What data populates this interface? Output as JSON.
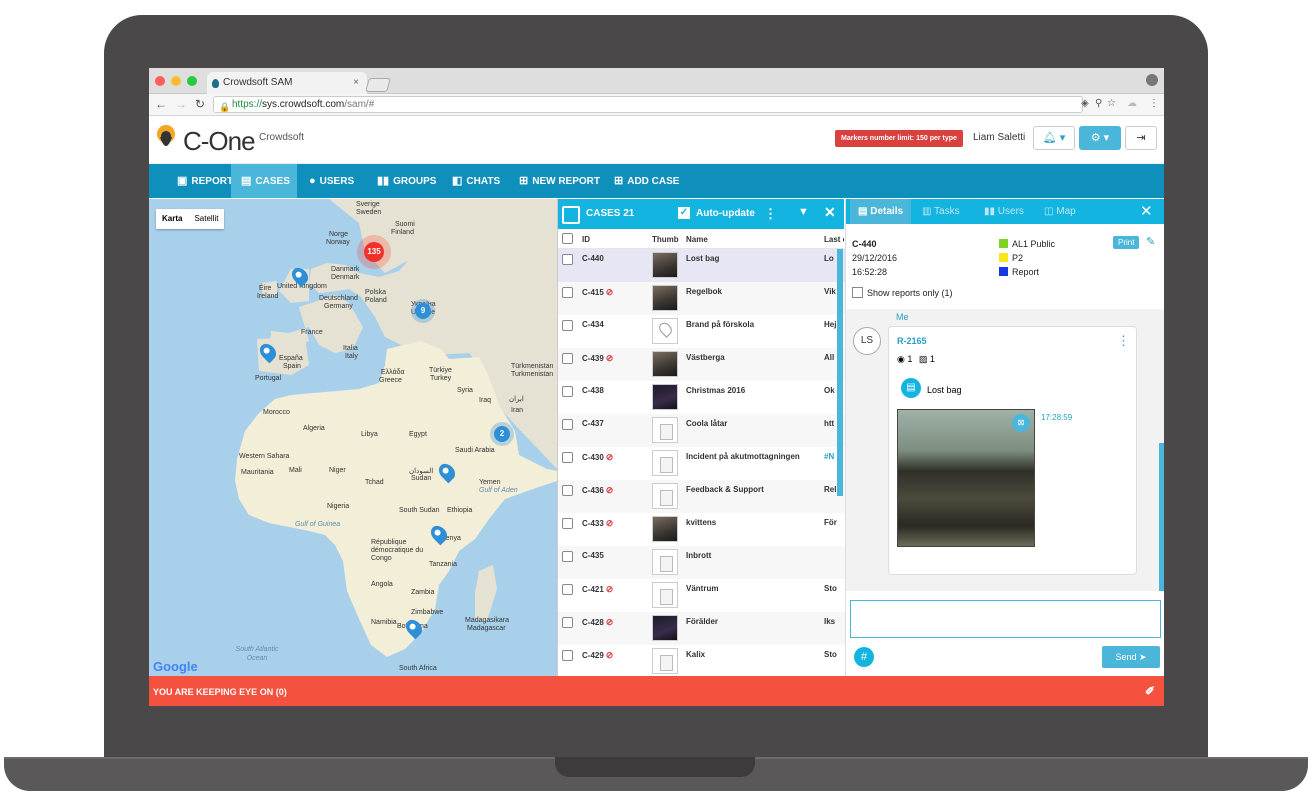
{
  "browser": {
    "tab_title": "Crowdsoft SAM",
    "tab_close": "×",
    "url_scheme": "https://",
    "url_host": "sys.crowdsoft.com",
    "url_path": "/sam/#"
  },
  "header": {
    "logo_text": "C-One",
    "org_name": "Crowdsoft",
    "limit_badge": "Markers number limit: 150 per type",
    "user_name": "Liam Saletti"
  },
  "nav": {
    "items": [
      {
        "label": "REPORTS",
        "icon": "reports-icon"
      },
      {
        "label": "CASES",
        "icon": "cases-icon"
      },
      {
        "label": "USERS",
        "icon": "users-icon"
      },
      {
        "label": "GROUPS",
        "icon": "groups-icon"
      },
      {
        "label": "CHATS",
        "icon": "chats-icon"
      },
      {
        "label": "NEW REPORT",
        "icon": "new-report-icon"
      },
      {
        "label": "ADD CASE",
        "icon": "add-case-icon"
      }
    ]
  },
  "map": {
    "type_map": "Karta",
    "type_satellite": "Satellit",
    "google": "Google",
    "clusters": [
      "135",
      "9",
      "2"
    ],
    "labels": {
      "sverige": "Sverige",
      "sweden": "Sweden",
      "suomi": "Suomi",
      "finland": "Finland",
      "norge": "Norge",
      "norway": "Norway",
      "danmark": "Danmark",
      "denmark": "Denmark",
      "eire": "Éire",
      "ireland": "Ireland",
      "united_kingdom": "United Kingdom",
      "deutschland": "Deutschland",
      "germany": "Germany",
      "polska": "Polska",
      "poland": "Poland",
      "ukraina": "Україна",
      "ukraine": "Ukraine",
      "france": "France",
      "italia": "Italia",
      "italy": "Italy",
      "espana": "España",
      "spain": "Spain",
      "portugal": "Portugal",
      "greece": "Ελλάδα",
      "greece_en": "Greece",
      "turkiye": "Türkiye",
      "turkey": "Turkey",
      "turkmenistan": "Türkmenistan",
      "turkmenistan_en": "Turkmenistan",
      "iran": "ایران",
      "iran_en": "Iran",
      "iraq": "Iraq",
      "syria": "Syria",
      "morocco": "Morocco",
      "algeria": "Algeria",
      "libya": "Libya",
      "egypt": "Egypt",
      "saudi": "Saudi Arabia",
      "western_sahara": "Western Sahara",
      "mauritania": "Mauritania",
      "mali": "Mali",
      "niger": "Niger",
      "chad": "Tchad",
      "sudan": "السودان",
      "sudan_en": "Sudan",
      "yemen": "Yemen",
      "south_sudan": "South Sudan",
      "ethiopia": "Ethiopia",
      "nigeria": "Nigeria",
      "drc": "République démocratique du Congo",
      "kenya": "Kenya",
      "tanzania": "Tanzania",
      "angola": "Angola",
      "zambia": "Zambia",
      "zimbabwe": "Zimbabwe",
      "namibia": "Namibia",
      "botswana": "Botswana",
      "madagascar": "Madagasikara",
      "madagascar_en": "Madagascar",
      "south_africa": "South Africa",
      "south_atlantic": "South Atlantic Ocean",
      "gulf_of_guinea": "Gulf of Guinea",
      "gulf_of_aden": "Gulf of Aden"
    }
  },
  "cases": {
    "title": "CASES 21",
    "auto_update": "Auto-update",
    "columns": {
      "id": "ID",
      "thumb": "Thumb",
      "name": "Name",
      "last": "Last c"
    },
    "rows": [
      {
        "id": "C-440",
        "name": "Lost bag",
        "last": "Lo",
        "flag": false,
        "thumb": "photo"
      },
      {
        "id": "C-415",
        "name": "Regelbok",
        "last": "Vik",
        "flag": true,
        "thumb": "photo"
      },
      {
        "id": "C-434",
        "name": "Brand på förskola",
        "last": "Hej",
        "flag": false,
        "thumb": "pinic"
      },
      {
        "id": "C-439",
        "name": "Västberga",
        "last": "All",
        "flag": true,
        "thumb": "photo"
      },
      {
        "id": "C-438",
        "name": "Christmas 2016",
        "last": "Ok",
        "flag": false,
        "thumb": "dark"
      },
      {
        "id": "C-437",
        "name": "Coola låtar",
        "last": "htt",
        "flag": false,
        "thumb": "blank"
      },
      {
        "id": "C-430",
        "name": "Incident på akutmottagningen",
        "last": "#N",
        "flag": true,
        "thumb": "blank"
      },
      {
        "id": "C-436",
        "name": "Feedback & Support",
        "last": "Rel",
        "flag": true,
        "thumb": "blank"
      },
      {
        "id": "C-433",
        "name": "kvittens",
        "last": "För",
        "flag": true,
        "thumb": "photo"
      },
      {
        "id": "C-435",
        "name": "Inbrott",
        "last": "",
        "flag": false,
        "thumb": "blank"
      },
      {
        "id": "C-421",
        "name": "Väntrum",
        "last": "Sto",
        "flag": true,
        "thumb": "blank"
      },
      {
        "id": "C-428",
        "name": "Förälder",
        "last": "Iks",
        "flag": true,
        "thumb": "dark"
      },
      {
        "id": "C-429",
        "name": "Kalix",
        "last": "Sto",
        "flag": true,
        "thumb": "blank"
      }
    ]
  },
  "details": {
    "tabs": [
      "Details",
      "Tasks",
      "Users",
      "Map"
    ],
    "case_id": "C-440",
    "date": "29/12/2016",
    "time": "16:52:28",
    "print": "Print",
    "legend": [
      {
        "label": "AL1 Public",
        "color": "#7ed321"
      },
      {
        "label": "P2",
        "color": "#f8e71c"
      },
      {
        "label": "Report",
        "color": "#1739e0"
      }
    ],
    "show_reports": "Show reports only (1)",
    "feed": {
      "author": "Me",
      "avatar": "LS",
      "report_id": "R-2165",
      "count_a": "1",
      "count_b": "1",
      "report_name": "Lost bag",
      "timestamp": "17:28:59"
    },
    "send": "Send",
    "hash": "#"
  },
  "footer": {
    "text": "YOU ARE KEEPING EYE ON (0)"
  },
  "colors": {
    "nav_bg": "#0f8fbb",
    "accent": "#14b4e0",
    "footer_bg": "#f4523e",
    "badge": "#d9413f"
  }
}
